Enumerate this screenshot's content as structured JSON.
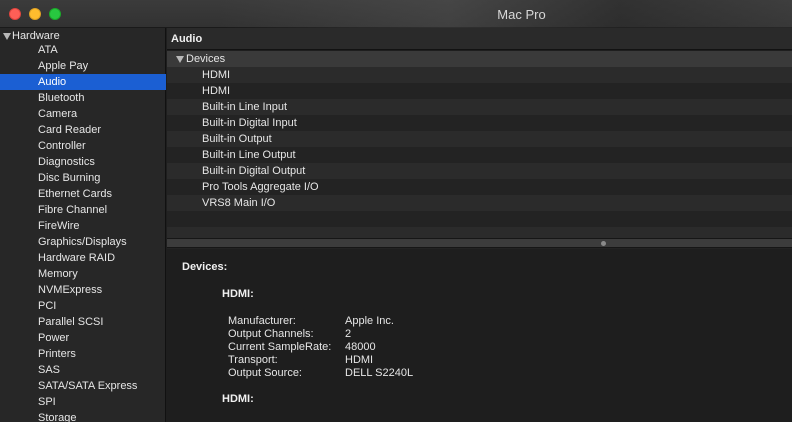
{
  "window": {
    "title": "Mac Pro"
  },
  "sidebar": {
    "group_label": "Hardware",
    "items": [
      {
        "label": "ATA"
      },
      {
        "label": "Apple Pay"
      },
      {
        "label": "Audio",
        "selected": true
      },
      {
        "label": "Bluetooth"
      },
      {
        "label": "Camera"
      },
      {
        "label": "Card Reader"
      },
      {
        "label": "Controller"
      },
      {
        "label": "Diagnostics"
      },
      {
        "label": "Disc Burning"
      },
      {
        "label": "Ethernet Cards"
      },
      {
        "label": "Fibre Channel"
      },
      {
        "label": "FireWire"
      },
      {
        "label": "Graphics/Displays"
      },
      {
        "label": "Hardware RAID"
      },
      {
        "label": "Memory"
      },
      {
        "label": "NVMExpress"
      },
      {
        "label": "PCI"
      },
      {
        "label": "Parallel SCSI"
      },
      {
        "label": "Power"
      },
      {
        "label": "Printers"
      },
      {
        "label": "SAS"
      },
      {
        "label": "SATA/SATA Express"
      },
      {
        "label": "SPI"
      },
      {
        "label": "Storage"
      }
    ]
  },
  "main": {
    "section_title": "Audio",
    "devices_group_label": "Devices",
    "devices": [
      {
        "label": "HDMI"
      },
      {
        "label": "HDMI"
      },
      {
        "label": "Built-in Line Input"
      },
      {
        "label": "Built-in Digital Input"
      },
      {
        "label": "Built-in Output"
      },
      {
        "label": "Built-in Line Output"
      },
      {
        "label": "Built-in Digital Output"
      },
      {
        "label": "Pro Tools Aggregate I/O"
      },
      {
        "label": "VRS8 Main I/O"
      }
    ],
    "detail": {
      "title": "Devices:",
      "entries": [
        {
          "name": "HDMI:",
          "properties": [
            {
              "label": "Manufacturer:",
              "value": "Apple Inc."
            },
            {
              "label": "Output Channels:",
              "value": "2"
            },
            {
              "label": "Current SampleRate:",
              "value": "48000"
            },
            {
              "label": "Transport:",
              "value": "HDMI"
            },
            {
              "label": "Output Source:",
              "value": "DELL S2240L"
            }
          ]
        },
        {
          "name": "HDMI:",
          "properties": []
        }
      ]
    }
  },
  "colors": {
    "selection": "#1b5fd3",
    "close": "#fe5f57",
    "minimize": "#febc2e",
    "maximize": "#28c840"
  }
}
